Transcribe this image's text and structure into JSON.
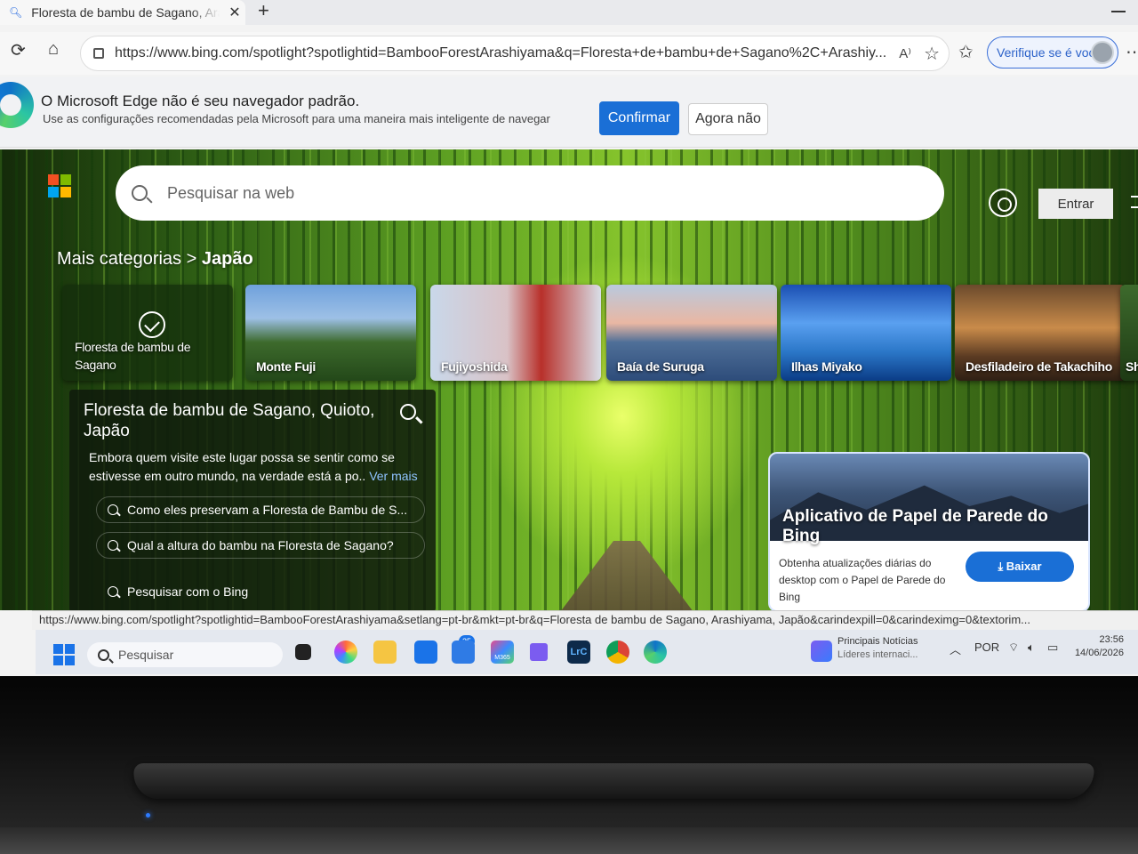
{
  "tab": {
    "title": "Floresta de bambu de Sagano, Arashiyama",
    "close": "✕",
    "new_tab": "+"
  },
  "addressbar": {
    "url": "https://www.bing.com/spotlight?spotlightid=BambooForestArashiyama&q=Floresta+de+bambu+de+Sagano%2C+Arashiy...",
    "read_aloud": "A⁾",
    "verify_label": "Verifique se é você"
  },
  "banner": {
    "title": "O Microsoft Edge não é seu navegador padrão.",
    "subtitle": "Use as configurações recomendadas pela Microsoft para uma maneira mais inteligente de navegar",
    "confirm_label": "Confirmar",
    "later_label": "Agora não"
  },
  "bing": {
    "search_placeholder": "Pesquisar na web",
    "signin_label": "Entrar",
    "breadcrumb_parent": "Mais categorias",
    "breadcrumb_sep": ">",
    "breadcrumb_current": "Japão",
    "categories": [
      {
        "label": "Floresta de bambu de Sagano",
        "active": true
      },
      {
        "label": "Monte Fuji"
      },
      {
        "label": "Fujiyoshida"
      },
      {
        "label": "Baía de Suruga"
      },
      {
        "label": "Ilhas Miyako"
      },
      {
        "label": "Desfiladeiro de Takachiho"
      },
      {
        "label": "Shiz"
      }
    ],
    "info": {
      "title": "Floresta de bambu de Sagano, Quioto, Japão",
      "description": "Embora quem visite este lugar possa se sentir como se estivesse em outro mundo, na verdade está a po..",
      "more_link": "Ver mais",
      "questions": [
        "Como eles preservam a Floresta de Bambu de S...",
        "Qual a altura do bambu na Floresta de Sagano?",
        "Pesquisar com o Bing"
      ]
    },
    "app_card": {
      "title": "Aplicativo de Papel de Parede do Bing",
      "text": "Obtenha atualizações diárias do desktop com o Papel de Parede do Bing",
      "download_label": "Baixar"
    }
  },
  "status_url": "https://www.bing.com/spotlight?spotlightid=BambooForestArashiyama&setlang=pt-br&mkt=pt-br&q=Floresta de bambu de Sagano, Arashiyama, Japão&carindexpill=0&carindeximg=0&textorim...",
  "taskbar": {
    "search_placeholder": "Pesquisar",
    "mail_badge": "25",
    "news_title": "Principais Notícias",
    "news_subtitle": "Líderes internaci...",
    "language": "POR",
    "time": "23:56",
    "date": "14/06/2026",
    "app_labels": [
      "M365",
      "LrC"
    ]
  },
  "colors": {
    "accent": "#1a6fd6",
    "ms_red": "#f25022",
    "ms_green": "#7fba00",
    "ms_blue": "#00a4ef",
    "ms_yellow": "#ffb900"
  }
}
